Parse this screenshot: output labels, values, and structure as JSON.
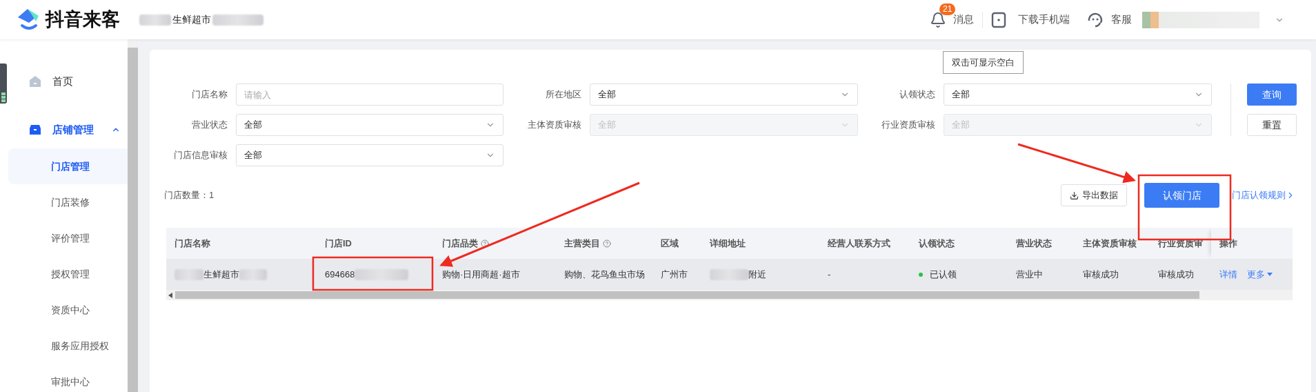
{
  "header": {
    "logo_text": "抖音来客",
    "store_name": "生鲜超市",
    "notice": {
      "label": "消息",
      "badge": "21"
    },
    "download": "下载手机端",
    "service": "客服",
    "tooltip": "双击可显示空白"
  },
  "sidebar": {
    "items": [
      {
        "kind": "item",
        "label": "首页",
        "selected": false
      },
      {
        "kind": "group",
        "label": "店铺管理",
        "selected": true,
        "expanded": true,
        "children": [
          {
            "label": "门店管理",
            "selected": true
          },
          {
            "label": "门店装修",
            "selected": false
          },
          {
            "label": "评价管理",
            "selected": false
          },
          {
            "label": "授权管理",
            "selected": false
          },
          {
            "label": "资质中心",
            "selected": false
          },
          {
            "label": "服务应用授权",
            "selected": false
          },
          {
            "label": "审批中心",
            "selected": false
          }
        ]
      }
    ]
  },
  "filters": [
    {
      "label": "门店名称",
      "placeholder": "请输入",
      "kind": "input",
      "disabled": false
    },
    {
      "label": "所在地区",
      "value": "全部",
      "kind": "select",
      "disabled": false
    },
    {
      "label": "认领状态",
      "value": "全部",
      "kind": "select",
      "disabled": false
    },
    {
      "label": "营业状态",
      "value": "全部",
      "kind": "select",
      "disabled": false
    },
    {
      "label": "主体资质审核",
      "value": "全部",
      "kind": "select",
      "disabled": true
    },
    {
      "label": "行业资质审核",
      "value": "全部",
      "kind": "select",
      "disabled": true
    },
    {
      "label": "门店信息审核",
      "value": "全部",
      "kind": "select",
      "disabled": false
    }
  ],
  "filter_buttons": {
    "query": "查询",
    "reset": "重置"
  },
  "count": "门店数量：1",
  "toolbar": {
    "export": "导出数据",
    "claim": "认领门店",
    "rules": "门店认领规则"
  },
  "table": {
    "columns": [
      {
        "label": "门店名称",
        "help": false
      },
      {
        "label": "门店ID",
        "help": false
      },
      {
        "label": "门店品类",
        "help": true
      },
      {
        "label": "主营类目",
        "help": true
      },
      {
        "label": "区域",
        "help": false
      },
      {
        "label": "详细地址",
        "help": false
      },
      {
        "label": "经营人联系方式",
        "help": false
      },
      {
        "label": "认领状态",
        "help": false
      },
      {
        "label": "营业状态",
        "help": false
      },
      {
        "label": "主体资质审核",
        "help": false
      },
      {
        "label": "行业资质审",
        "help": false
      },
      {
        "label": "操作",
        "help": false
      }
    ],
    "rows": [
      {
        "name": "生鲜超市",
        "id": "694668",
        "category": "购物·日用商超·超市",
        "main_category": "购物、花鸟鱼虫市场",
        "region": "广州市",
        "address": "附近",
        "contact": "-",
        "claim_status": {
          "text": "已认领",
          "color": "#2bbf4c"
        },
        "business_status": "营业中",
        "entity_review": "审核成功",
        "industry_review": "审核成功",
        "actions": {
          "detail": "详情",
          "more": "更多"
        }
      }
    ]
  }
}
